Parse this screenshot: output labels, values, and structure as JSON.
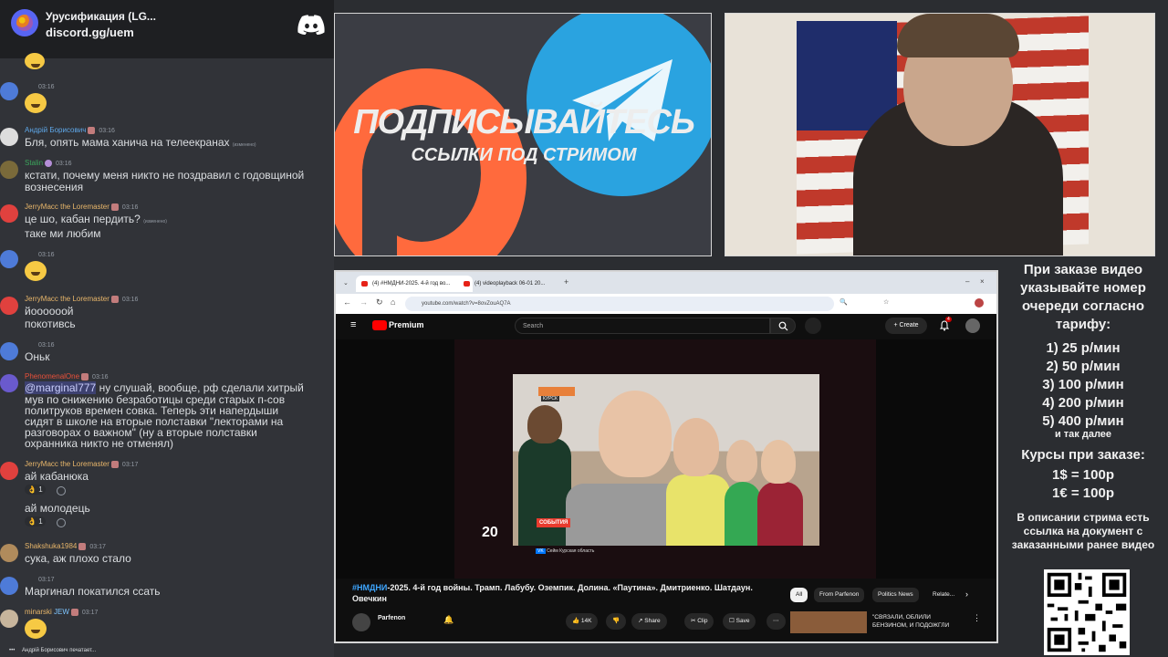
{
  "discord": {
    "server_name": "Урусификация (LG...",
    "invite_link": "discord.gg/uem",
    "typing_indicator": "Андрій Борисович печатает..."
  },
  "chat": {
    "messages": [
      {
        "kind": "emoji-only",
        "timestamp": ""
      },
      {
        "kind": "emoji-only",
        "user": "",
        "timestamp": "03:16"
      },
      {
        "user": "Андрій Борисович",
        "timestamp": "03:16",
        "text": "Бля, опять мама ханича на телеекранах",
        "edited": "(изменено)"
      },
      {
        "user": "Stalin",
        "timestamp": "03:16",
        "text_lines": [
          "кстати, почему меня никто не поздравил с годовщиной",
          "вознесения"
        ]
      },
      {
        "user": "JerryMacc the Loremaster",
        "timestamp": "03:16",
        "text_lines": [
          "це шо, кабан пердить?",
          "таке ми любим"
        ],
        "edited": "(изменено)"
      },
      {
        "kind": "emoji-only",
        "user": "",
        "timestamp": "03:16"
      },
      {
        "user": "JerryMacc the Loremaster",
        "timestamp": "03:16",
        "text_lines": [
          "йоооооой",
          "покотивсь"
        ]
      },
      {
        "user": "",
        "timestamp": "03:16",
        "text": "Оньк"
      },
      {
        "user": "PhenomenalOne",
        "timestamp": "03:16",
        "mention": "@marginal777",
        "text_lines": [
          "ну слушай, вообще, рф сделали хитрый",
          "мув по снижению безработицы среди старых п-сов",
          "политруков времен совка. Теперь эти напердыши",
          "сидят в школе на вторые полставки \"лекторами на",
          "разговорах о важном\" (ну а вторые полставки",
          "охранника никто не отменял)"
        ]
      },
      {
        "user": "JerryMacc the Loremaster",
        "timestamp": "03:17",
        "text_lines": [
          "ай кабанюка",
          "ай молодець"
        ],
        "reactions": [
          "1",
          "1"
        ]
      },
      {
        "user": "Shakshuka1984",
        "timestamp": "03:17",
        "text": "сука, аж плохо стало"
      },
      {
        "user": "",
        "timestamp": "03:17",
        "text": "Маргинал покатился ссать"
      },
      {
        "user": "minarski",
        "tag": "JEW",
        "timestamp": "03:17",
        "kind": "emoji-only"
      }
    ]
  },
  "promo": {
    "title": "ПОДПИСЫВАЙТЕСЬ",
    "subtitle": "ССЫЛКИ ПОД СТРИМОМ"
  },
  "browser": {
    "tabs": [
      {
        "label": "(4) #НМДНИ-2025. 4-й год во..."
      },
      {
        "label": "(4) videoplayback 06-01 20..."
      }
    ],
    "url": "youtube.com/watch?v=8ovZouAQ7A",
    "youtube": {
      "brand": "Premium",
      "search_placeholder": "Search",
      "create_label": "Create",
      "notification_count": "4",
      "video_title_hash": "#НМДНИ",
      "video_title_rest": "-2025. 4-й год войны. Трамп. Лабубу. Оземпик. Долина. «Паутина». Дмитриенко. Шатдаун. Овечкин",
      "overlay_tag": "СОБЫТИЯ",
      "overlay_number": "20",
      "overlay_kursk": "КУРСК",
      "overlay_source": "Сейм Курская область",
      "channel_name": "Parfenon",
      "likes": "14K",
      "share_label": "Share",
      "clip_label": "Clip",
      "save_label": "Save",
      "chips": [
        "All",
        "From Parfenon",
        "Politics News",
        "Relate..."
      ],
      "rec_title_lines": [
        "\"СВЯЗАЛИ, ОБЛИЛИ",
        "БЕНЗИНОМ, И ПОДОЖГЛИ"
      ]
    }
  },
  "info": {
    "order_heading": "При заказе видео указывайте номер очереди согласно тарифу:",
    "tariffs": [
      "1) 25 р/мин",
      "2) 50 р/мин",
      "3) 100 р/мин",
      "4) 200 р/мин",
      "5) 400 р/мин"
    ],
    "tariff_more": "и так далее",
    "rates_heading": "Курсы при заказе:",
    "rates": [
      "1$ = 100р",
      "1€ = 100р"
    ],
    "description_note": "В описании стрима есть ссылка на документ с заказанными ранее видео"
  }
}
